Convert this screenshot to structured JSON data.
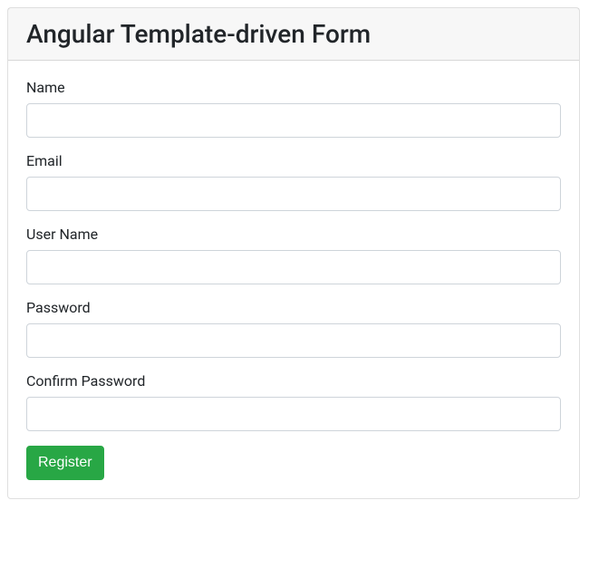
{
  "header": {
    "title": "Angular Template-driven Form"
  },
  "form": {
    "fields": [
      {
        "label": "Name",
        "value": "",
        "type": "text"
      },
      {
        "label": "Email",
        "value": "",
        "type": "text"
      },
      {
        "label": "User Name",
        "value": "",
        "type": "text"
      },
      {
        "label": "Password",
        "value": "",
        "type": "password"
      },
      {
        "label": "Confirm Password",
        "value": "",
        "type": "password"
      }
    ],
    "submit_label": "Register"
  }
}
